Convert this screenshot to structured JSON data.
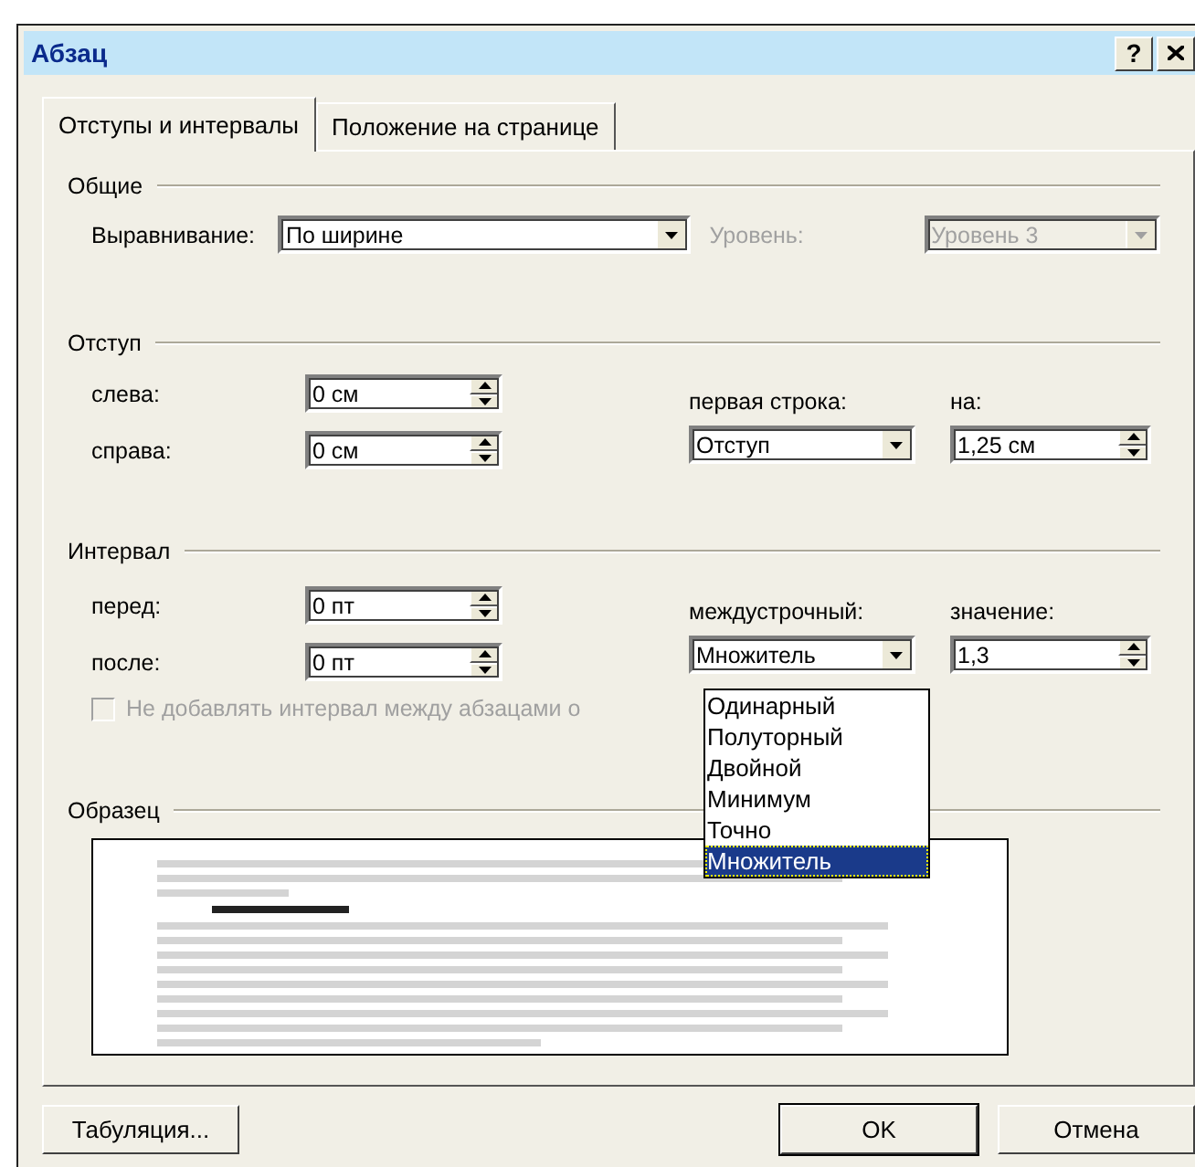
{
  "window": {
    "title": "Абзац",
    "help": "?"
  },
  "tabs": [
    {
      "label": "Отступы и интервалы",
      "selected": true
    },
    {
      "label": "Положение на странице",
      "selected": false
    }
  ],
  "general": {
    "title": "Общие",
    "alignment": {
      "label": "Выравнивание:",
      "value": "По ширине"
    },
    "outline_level": {
      "label": "Уровень:",
      "value": "Уровень 3",
      "disabled": true
    }
  },
  "indent": {
    "title": "Отступ",
    "left": {
      "label": "слева:",
      "value": "0 см"
    },
    "right": {
      "label": "справа:",
      "value": "0 см"
    },
    "first_line": {
      "label": "первая строка:",
      "value": "Отступ"
    },
    "by": {
      "label": "на:",
      "value": "1,25 см"
    }
  },
  "spacing": {
    "title": "Интервал",
    "before": {
      "label": "перед:",
      "value": "0 пт"
    },
    "after": {
      "label": "после:",
      "value": "0 пт"
    },
    "line_spacing": {
      "label": "междустрочный:",
      "value": "Множитель",
      "expanded": true,
      "options": [
        {
          "label": "Одинарный",
          "selected": false
        },
        {
          "label": "Полуторный",
          "selected": false
        },
        {
          "label": "Двойной",
          "selected": false
        },
        {
          "label": "Минимум",
          "selected": false
        },
        {
          "label": "Точно",
          "selected": false
        },
        {
          "label": "Множитель",
          "selected": true
        }
      ]
    },
    "at": {
      "label": "значение:",
      "value": "1,3"
    },
    "no_space": {
      "label": "Не добавлять интервал между абзацами о",
      "checked": false,
      "disabled": true
    }
  },
  "preview": {
    "title": "Образец"
  },
  "buttons": [
    {
      "label": "Табуляция...",
      "default": false
    },
    {
      "label": "OK",
      "default": true
    },
    {
      "label": "Отмена",
      "default": false
    }
  ]
}
